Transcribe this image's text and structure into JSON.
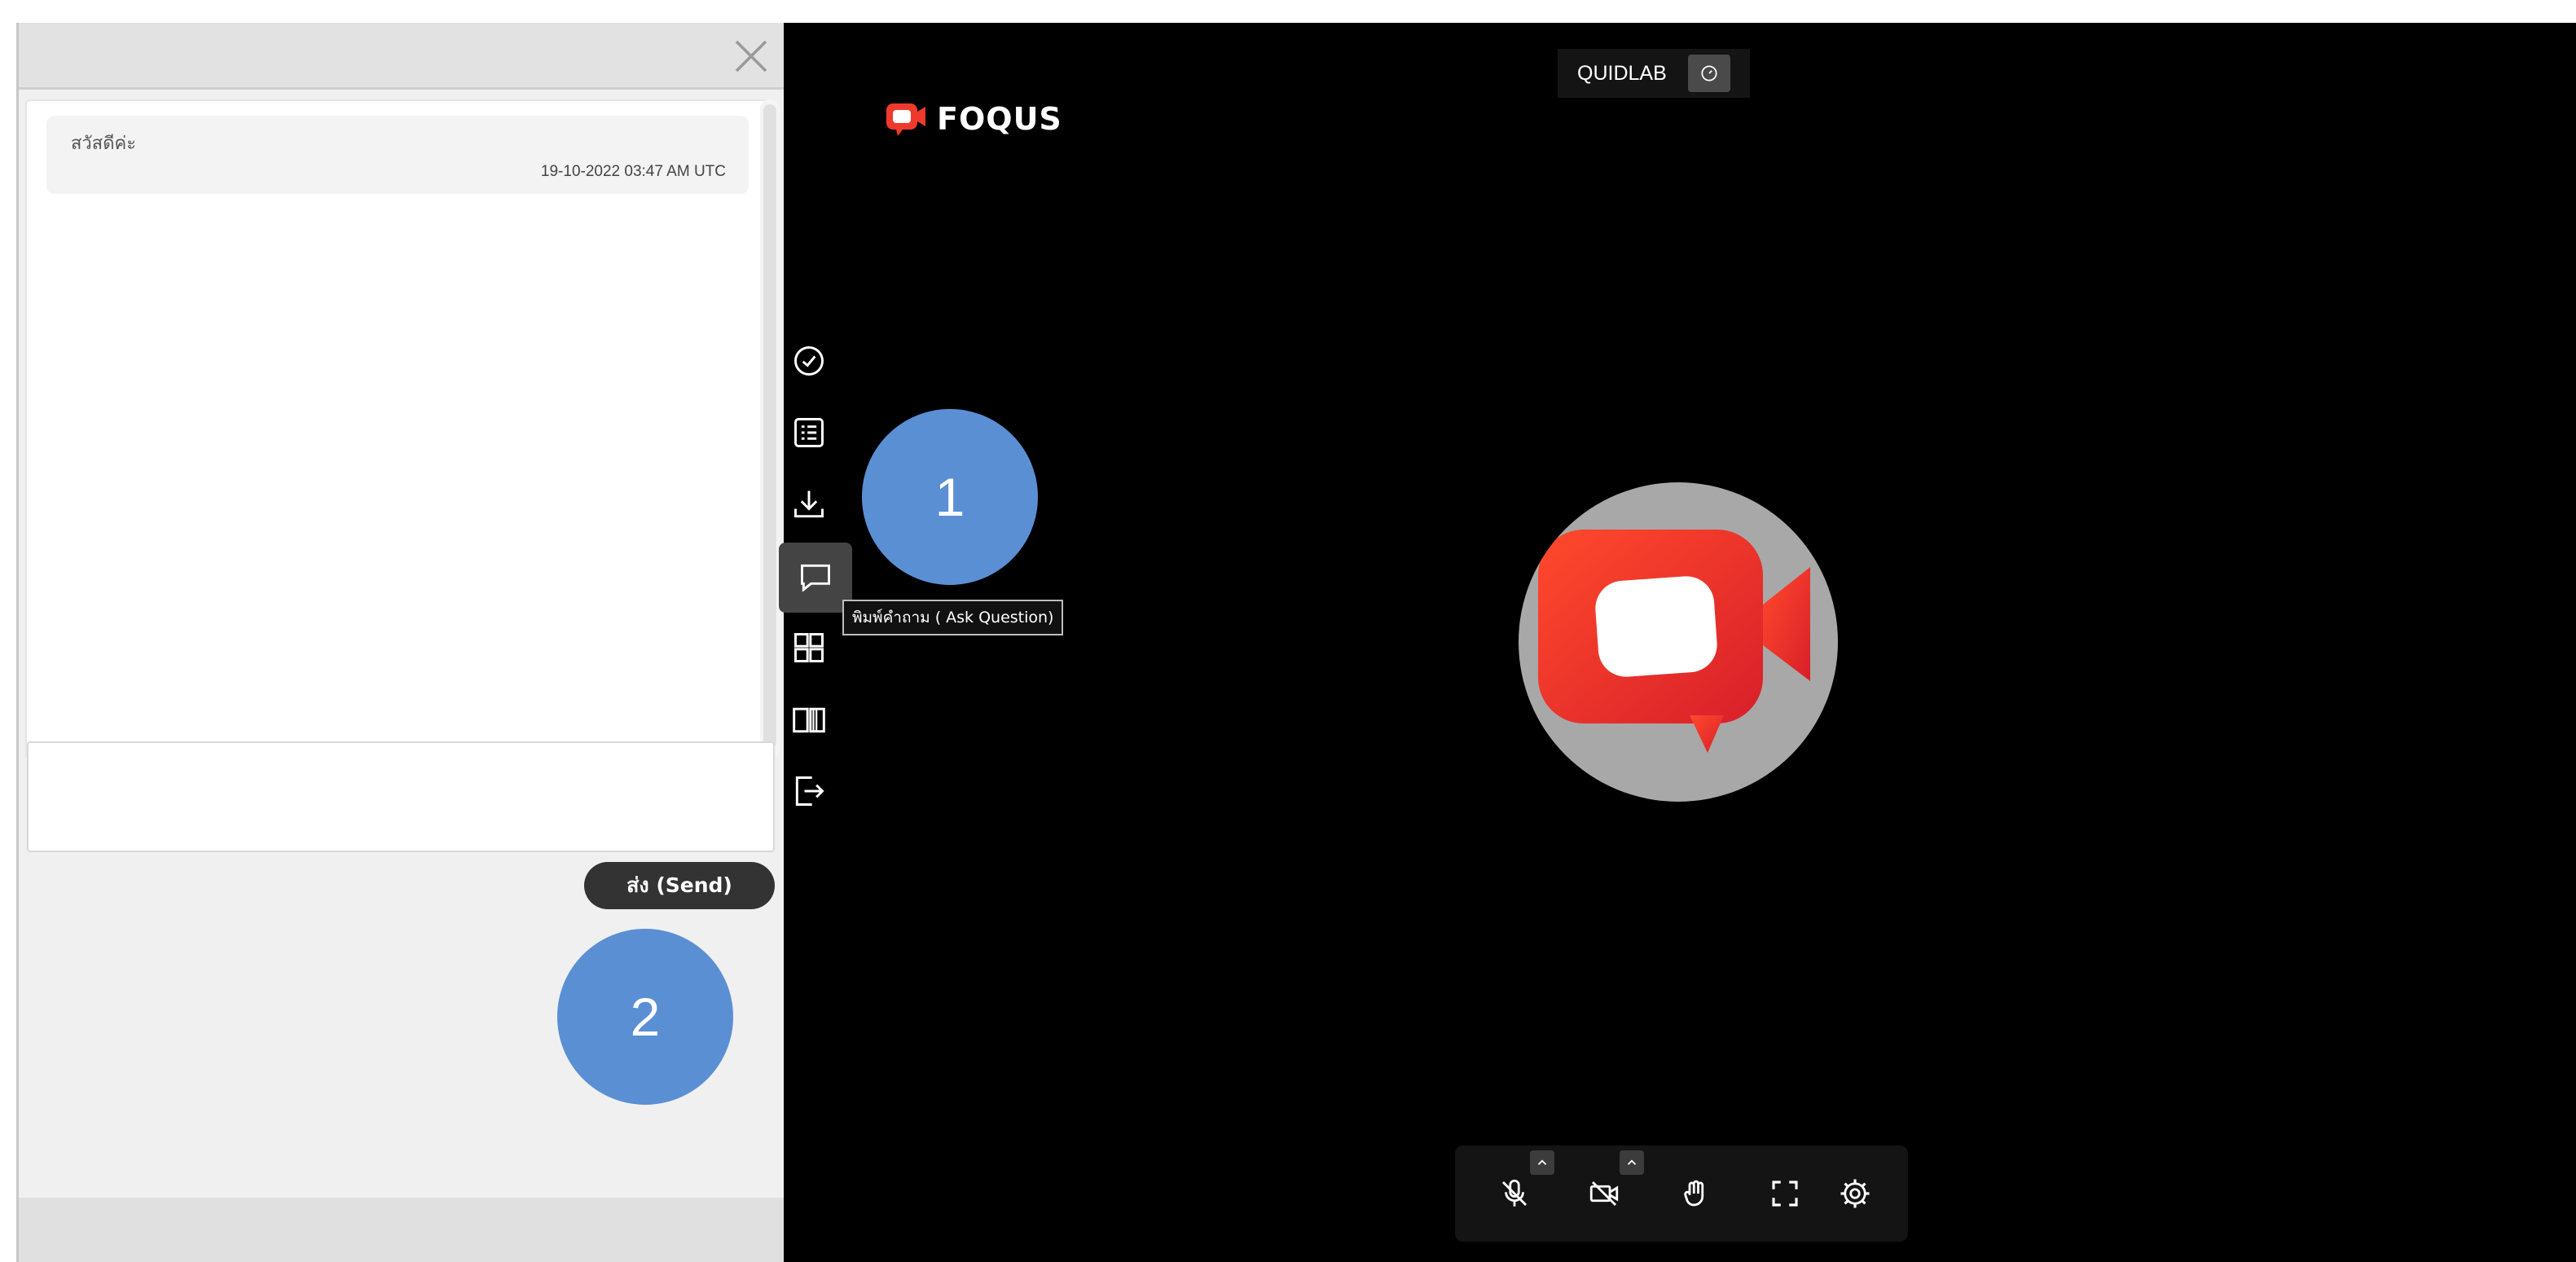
{
  "chat": {
    "messages": [
      {
        "text": "สวัสดีค่ะ",
        "timestamp": "19-10-2022 03:47 AM UTC"
      }
    ],
    "input_value": "",
    "input_placeholder": "",
    "send_label": "ส่ง (Send)",
    "close_icon": "close-icon"
  },
  "header": {
    "brand": "FOQUS",
    "room_name": "QUIDLAB",
    "meter_icon": "speedometer-icon"
  },
  "sidebar": {
    "items": [
      {
        "icon": "check-circle-icon",
        "active": false
      },
      {
        "icon": "list-icon",
        "active": false
      },
      {
        "icon": "download-icon",
        "active": false
      },
      {
        "icon": "chat-icon",
        "active": true
      },
      {
        "icon": "grid-icon",
        "active": false
      },
      {
        "icon": "book-icon",
        "active": false
      },
      {
        "icon": "exit-icon",
        "active": false
      }
    ],
    "tooltip": "พิมพ์คำถาม ( Ask Question)"
  },
  "controls": {
    "items": [
      "mic-off-icon",
      "camera-off-icon",
      "raise-hand-icon",
      "fullscreen-icon",
      "settings-icon"
    ]
  },
  "markers": [
    "1",
    "2"
  ],
  "colors": {
    "brand_red": "#ee3a2c",
    "marker_blue": "#5b8fd4",
    "video_bg": "#000000",
    "send_button": "#333333"
  }
}
